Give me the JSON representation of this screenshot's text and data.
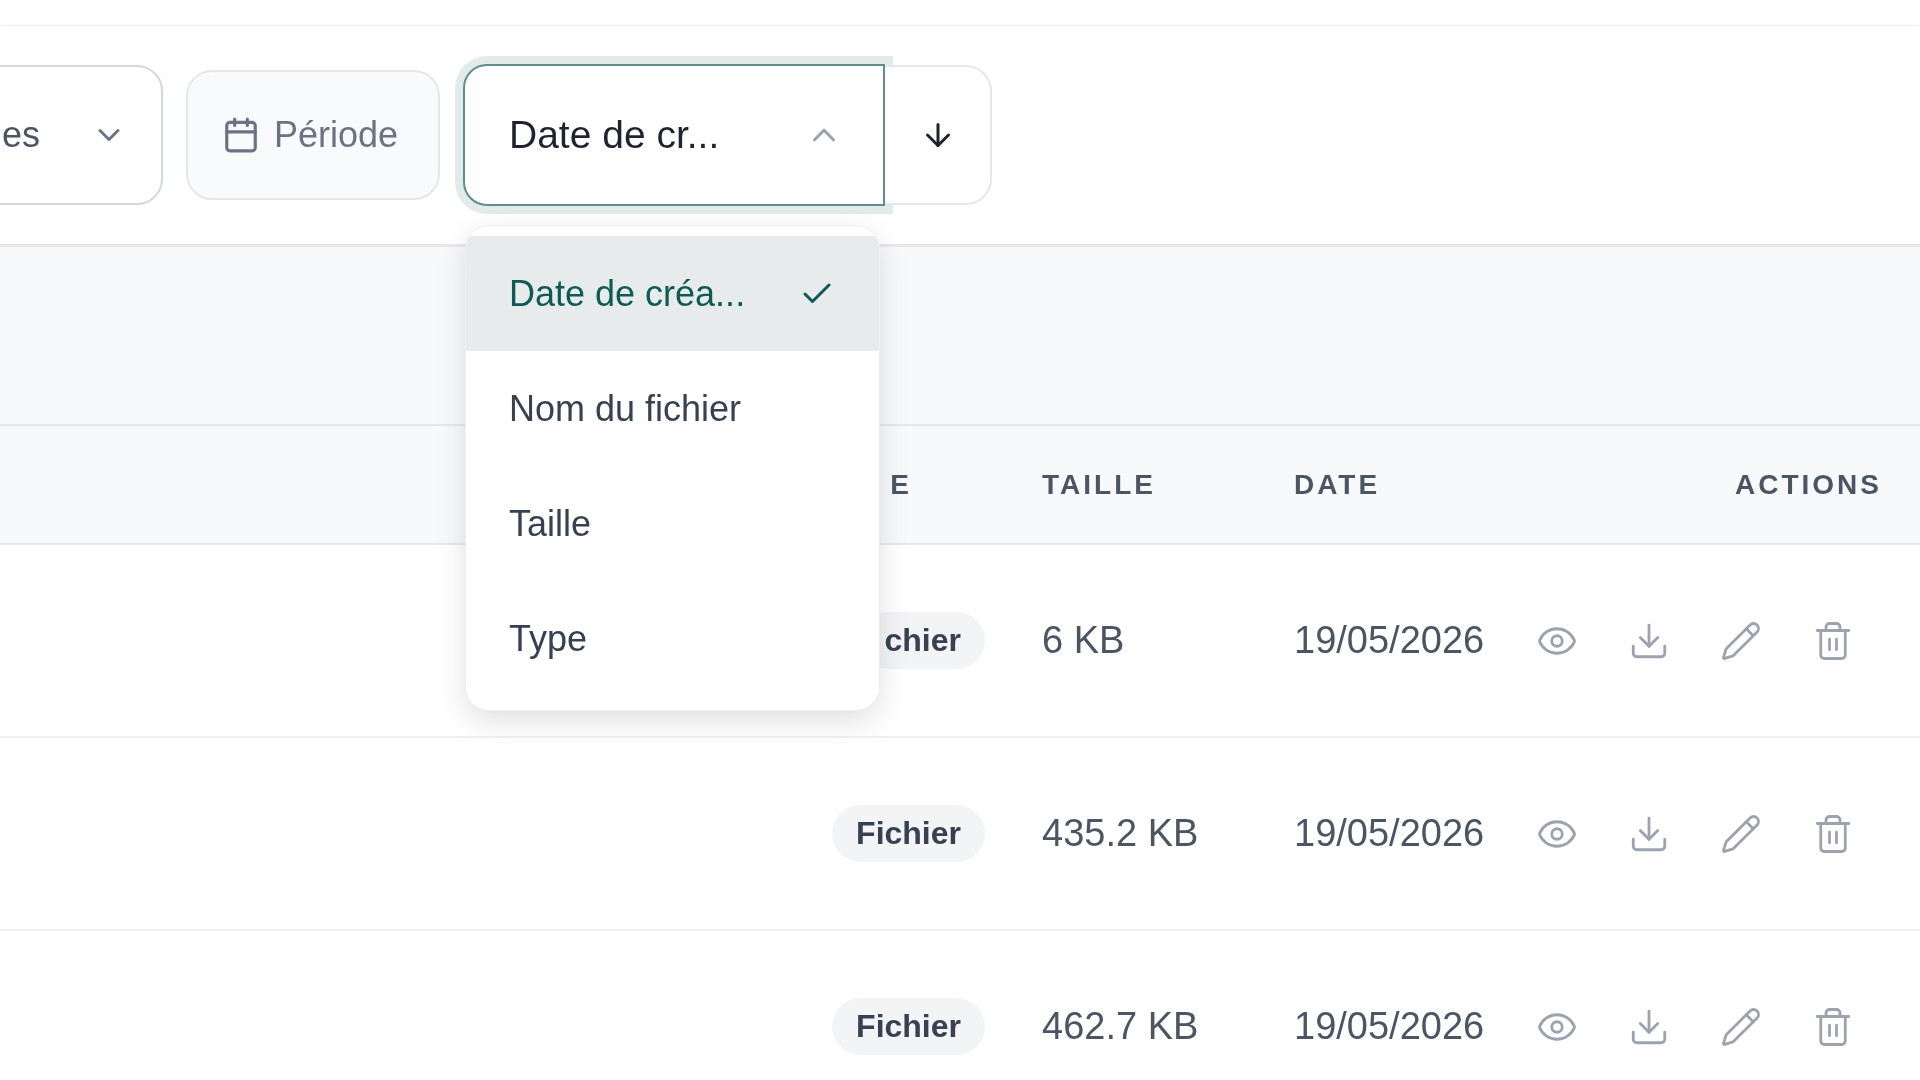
{
  "toolbar": {
    "type_filter": {
      "label": "es"
    },
    "period_button": {
      "label": "Période"
    },
    "sort_select": {
      "value": "Date de cr...",
      "expanded": true
    }
  },
  "sort_menu": {
    "options": [
      {
        "label": "Date de créa...",
        "selected": true
      },
      {
        "label": "Nom du fichier",
        "selected": false
      },
      {
        "label": "Taille",
        "selected": false
      },
      {
        "label": "Type",
        "selected": false
      }
    ]
  },
  "table": {
    "columns": [
      "E",
      "TAILLE",
      "DATE",
      "ACTIONS"
    ],
    "rows": [
      {
        "type": "chier",
        "size": "6 KB",
        "date": "19/05/2026"
      },
      {
        "type": "Fichier",
        "size": "435.2 KB",
        "date": "19/05/2026"
      },
      {
        "type": "Fichier",
        "size": "462.7 KB",
        "date": "19/05/2026"
      }
    ]
  }
}
